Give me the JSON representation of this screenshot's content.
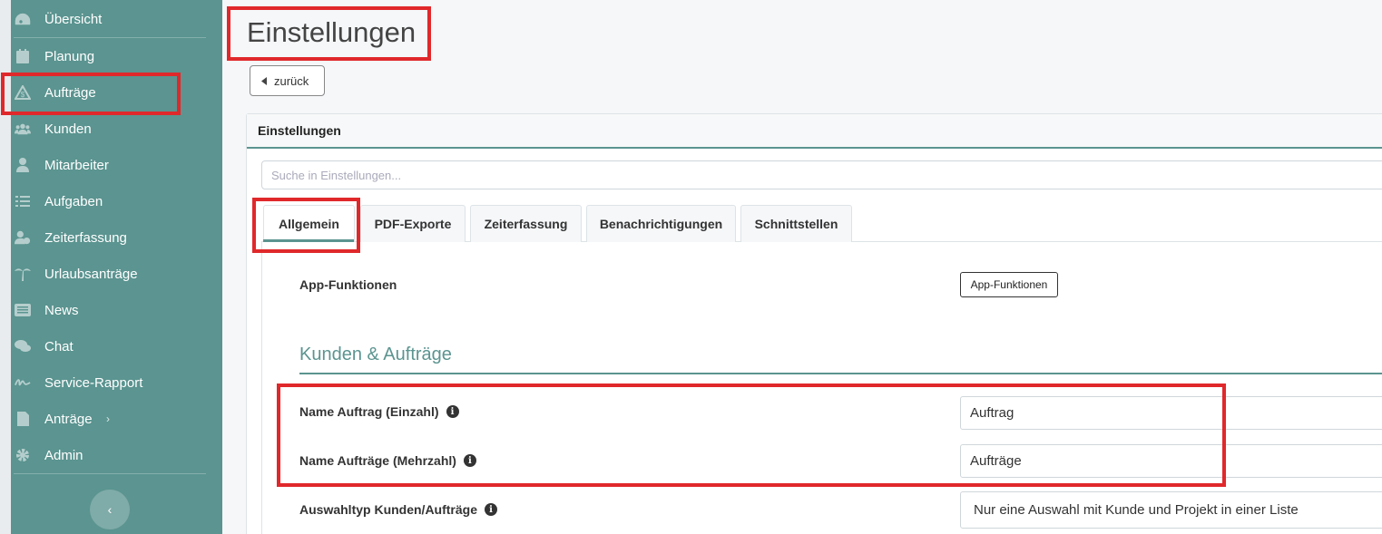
{
  "sidebar": {
    "items": [
      {
        "label": "Übersicht",
        "icon": "dashboard-icon"
      },
      {
        "label": "Planung",
        "icon": "calendar-icon"
      },
      {
        "label": "Aufträge",
        "icon": "orders-icon"
      },
      {
        "label": "Kunden",
        "icon": "users-icon"
      },
      {
        "label": "Mitarbeiter",
        "icon": "user-icon"
      },
      {
        "label": "Aufgaben",
        "icon": "tasks-icon"
      },
      {
        "label": "Zeiterfassung",
        "icon": "user-clock-icon"
      },
      {
        "label": "Urlaubsanträge",
        "icon": "palm-tree-icon"
      },
      {
        "label": "News",
        "icon": "newspaper-icon"
      },
      {
        "label": "Chat",
        "icon": "chat-icon"
      },
      {
        "label": "Service-Rapport",
        "icon": "signature-icon"
      },
      {
        "label": "Anträge",
        "icon": "document-icon",
        "chevron": "›"
      },
      {
        "label": "Admin",
        "icon": "gear-icon"
      }
    ],
    "collapse_icon": "‹"
  },
  "header": {
    "title": "Einstellungen",
    "back_label": "zurück"
  },
  "card": {
    "title": "Einstellungen",
    "search_placeholder": "Suche in Einstellungen...",
    "tabs": [
      {
        "label": "Allgemein"
      },
      {
        "label": "PDF-Exporte"
      },
      {
        "label": "Zeiterfassung"
      },
      {
        "label": "Benachrichtigungen"
      },
      {
        "label": "Schnittstellen"
      }
    ]
  },
  "settings": {
    "app_functions_label": "App-Funktionen",
    "app_functions_button": "App-Funktionen",
    "section_title": "Kunden & Aufträge",
    "name_singular_label": "Name Auftrag (Einzahl)",
    "name_singular_value": "Auftrag",
    "name_plural_label": "Name Aufträge (Mehrzahl)",
    "name_plural_value": "Aufträge",
    "selection_type_label": "Auswahltyp Kunden/Aufträge",
    "selection_type_value": "Nur eine Auswahl mit Kunde und Projekt in einer Liste"
  },
  "colors": {
    "sidebar": "#5b9490",
    "accent": "#5b9490",
    "highlight": "#e0282b"
  }
}
